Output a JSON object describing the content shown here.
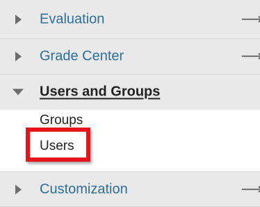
{
  "menu": {
    "evaluation": {
      "label": "Evaluation",
      "arrow": "⟶"
    },
    "grade_center": {
      "label": "Grade Center",
      "arrow": "⟶"
    },
    "users_and_groups": {
      "label": "Users and Groups",
      "children": [
        {
          "label": "Groups"
        },
        {
          "label": "Users"
        }
      ]
    },
    "customization": {
      "label": "Customization",
      "arrow": "⟶"
    }
  },
  "colors": {
    "link": "#2e6e98",
    "highlight": "#e8141b",
    "row_background": "#e9e9e9"
  }
}
